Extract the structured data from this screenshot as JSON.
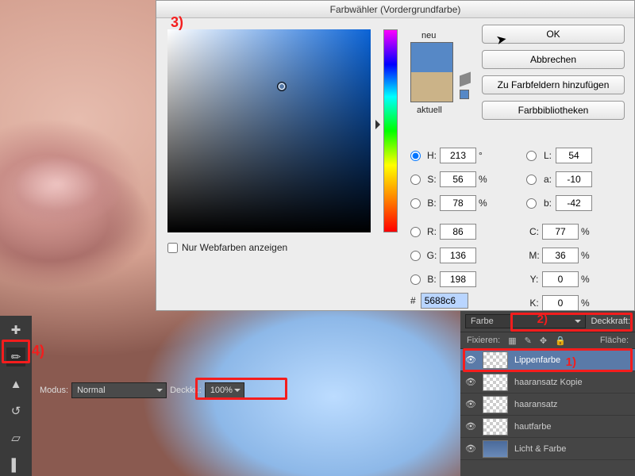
{
  "dialog": {
    "title": "Farbwähler (Vordergrundfarbe)",
    "new_label": "neu",
    "current_label": "aktuell",
    "buttons": {
      "ok": "OK",
      "cancel": "Abbrechen",
      "add_swatch": "Zu Farbfeldern hinzufügen",
      "libraries": "Farbbibliotheken"
    },
    "web_only": "Nur Webfarben anzeigen",
    "hsv": {
      "h": "213",
      "h_unit": "°",
      "s": "56",
      "b": "78"
    },
    "lab": {
      "l": "54",
      "a": "-10",
      "b": "-42"
    },
    "rgb": {
      "r": "86",
      "g": "136",
      "b": "198"
    },
    "cmyk": {
      "c": "77",
      "m": "36",
      "y": "0",
      "k": "0"
    },
    "hex": "5688c6",
    "picked_color": "#5688c6",
    "old_color": "#cbb388"
  },
  "toolbar_opts": {
    "mode_label": "Modus:",
    "mode_value": "Normal",
    "opacity_label": "Deckkr.:",
    "opacity_value": "100%"
  },
  "panel": {
    "blend_value": "Farbe",
    "lock_label": "Fixieren:",
    "fill_label": "Fläche:",
    "opacity_label": "Deckkraft:",
    "layers": [
      {
        "name": "Lippenfarbe",
        "active": true,
        "filled": false
      },
      {
        "name": "haaransatz Kopie",
        "active": false,
        "filled": false
      },
      {
        "name": "haaransatz",
        "active": false,
        "filled": false
      },
      {
        "name": "hautfarbe",
        "active": false,
        "filled": false
      },
      {
        "name": "Licht & Farbe",
        "active": false,
        "filled": true
      }
    ]
  },
  "annotations": {
    "a1": "1)",
    "a2": "2)",
    "a3": "3)",
    "a4": "4)"
  }
}
